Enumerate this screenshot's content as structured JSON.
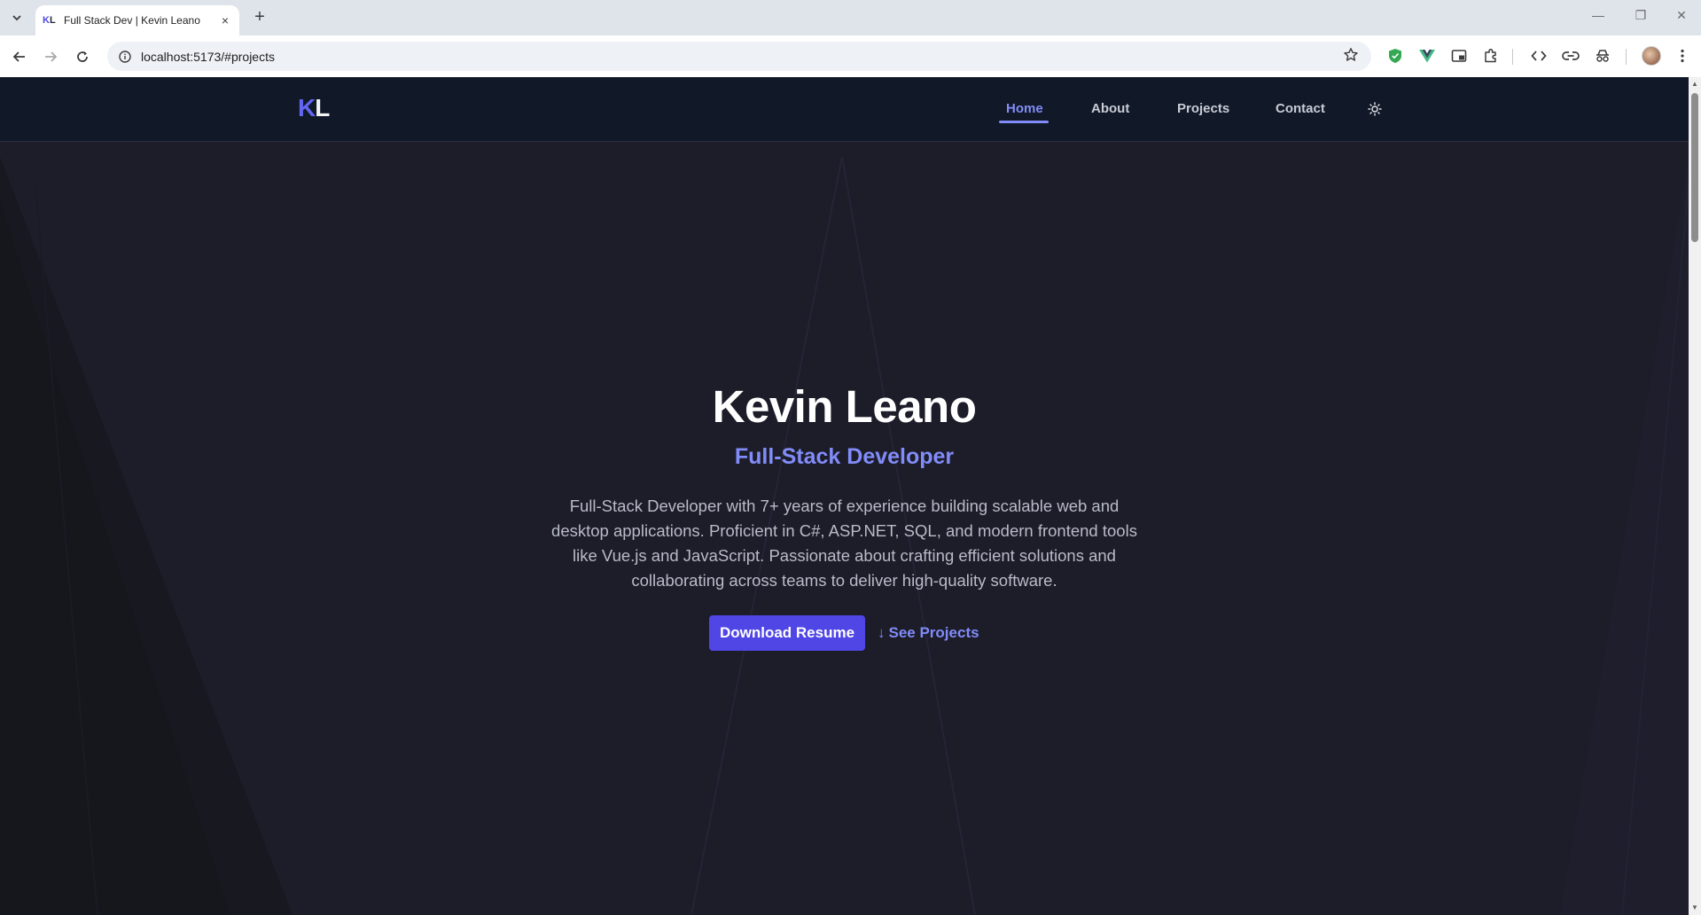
{
  "browser": {
    "tab": {
      "favicon_k": "K",
      "favicon_l": "L",
      "title": "Full Stack Dev | Kevin Leano",
      "close": "×"
    },
    "new_tab": "+",
    "window_controls": {
      "minimize": "—",
      "restore": "❐",
      "close": "✕"
    },
    "address": "localhost:5173/#projects"
  },
  "site": {
    "logo": {
      "first": "K",
      "second": "L"
    },
    "nav": {
      "items": [
        {
          "label": "Home",
          "active": true
        },
        {
          "label": "About",
          "active": false
        },
        {
          "label": "Projects",
          "active": false
        },
        {
          "label": "Contact",
          "active": false
        }
      ],
      "theme_icon": "sun-icon"
    },
    "hero": {
      "name": "Kevin Leano",
      "role": "Full-Stack Developer",
      "description": "Full-Stack Developer with 7+ years of experience building scalable web and desktop applications. Proficient in C#, ASP.NET, SQL, and modern frontend tools like Vue.js and JavaScript. Passionate about crafting efficient solutions and collaborating across teams to deliver high-quality software.",
      "primary_button": "Download Resume",
      "secondary_button": "See Projects",
      "secondary_arrow": "↓"
    }
  },
  "colors": {
    "accent": "#818cf8",
    "button": "#4f46e5",
    "nav_bg": "#111827",
    "page_bg": "#1d1c29"
  }
}
